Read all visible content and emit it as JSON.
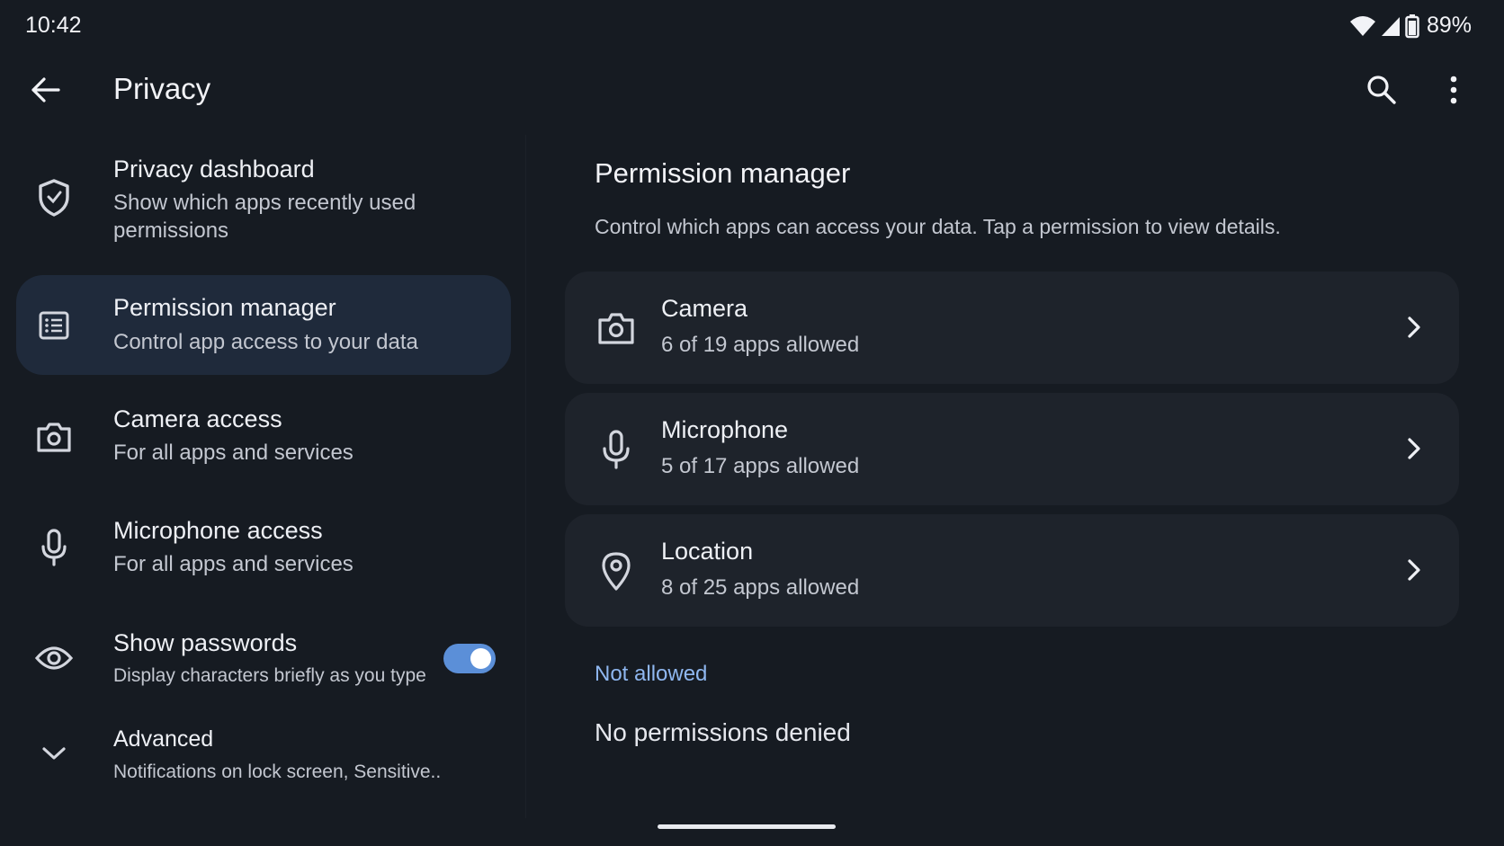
{
  "status_bar": {
    "time": "10:42",
    "battery": "89%"
  },
  "app_bar": {
    "title": "Privacy"
  },
  "left_list": {
    "items": [
      {
        "title": "Privacy dashboard",
        "subtitle": "Show which apps recently used permissions",
        "icon": "shield-icon"
      },
      {
        "title": "Permission manager",
        "subtitle": "Control app access to your data",
        "icon": "list-icon",
        "selected": true
      },
      {
        "title": "Camera access",
        "subtitle": "For all apps and services",
        "icon": "camera-icon"
      },
      {
        "title": "Microphone access",
        "subtitle": "For all apps and services",
        "icon": "microphone-icon"
      },
      {
        "title": "Show passwords",
        "subtitle": "Display characters briefly as you type",
        "icon": "eye-icon",
        "toggle_on": true
      },
      {
        "title": "Advanced",
        "subtitle": "Notifications on lock screen, Sensitive..",
        "icon": "chevron-down-icon"
      }
    ]
  },
  "pane": {
    "title": "Permission manager",
    "description": "Control which apps can access your data. Tap a permission to view details.",
    "cards": [
      {
        "title": "Camera",
        "subtitle": "6 of 19 apps allowed",
        "icon": "camera-icon"
      },
      {
        "title": "Microphone",
        "subtitle": "5 of 17 apps allowed",
        "icon": "microphone-icon"
      },
      {
        "title": "Location",
        "subtitle": "8 of 25 apps allowed",
        "icon": "location-pin-icon"
      }
    ],
    "not_allowed_label": "Not allowed",
    "not_allowed_text": "No permissions denied"
  },
  "colors": {
    "background": "#161b22",
    "selected_item": "#1f2a3b",
    "card": "#1e232b",
    "accent": "#8fb7f0",
    "toggle": "#5b8fd8"
  }
}
